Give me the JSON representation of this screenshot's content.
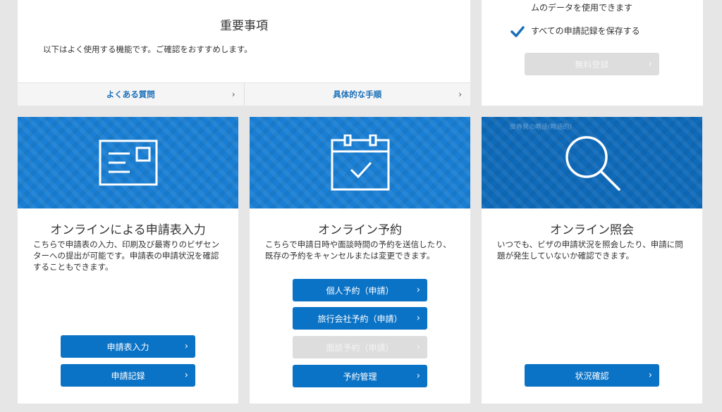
{
  "notice": {
    "title": "重要事項",
    "description": "以下はよく使用する機能です。ご確認をおすすめします。",
    "links": [
      {
        "label": "よくある質問"
      },
      {
        "label": "具体的な手順"
      }
    ],
    "chevron": "›"
  },
  "register": {
    "line1": "ムのデータを使用できます",
    "line2": "すべての申請記録を保存する",
    "button_label": "無料登録",
    "check_icon": "checkmark-icon",
    "check_color": "#1a6fb8"
  },
  "cards": [
    {
      "icon": "application-form-icon",
      "title": "オンラインによる申請表入力",
      "description": "こちらで申請表の入力、印刷及び最寄りのビザセンターへの提出が可能です。申請表の申請状況を確認することもできます。",
      "buttons": [
        {
          "label": "申請表入力",
          "disabled": false
        },
        {
          "label": "申請記録",
          "disabled": false
        }
      ]
    },
    {
      "icon": "calendar-check-icon",
      "title": "オンライン予約",
      "description": "こちらで申請日時や面談時間の予約を送信したり、既存の予約をキャンセルまたは変更できます。",
      "buttons": [
        {
          "label": "個人予約（申請）",
          "disabled": false
        },
        {
          "label": "旅行会社予約（申請）",
          "disabled": false
        },
        {
          "label": "面談予約（申請）",
          "disabled": true
        },
        {
          "label": "予約管理",
          "disabled": false
        }
      ]
    },
    {
      "icon": "search-icon",
      "banner_tag": "旅券発の略語(略語的)",
      "title": "オンライン照会",
      "description": "いつでも、ビザの申請状況を照会したり、申請に問題が発生していないか確認できます。",
      "buttons": [
        {
          "label": "状況確認",
          "disabled": false
        }
      ]
    }
  ],
  "colors": {
    "primary_button": "#0b73c6",
    "disabled_button": "#dddddd",
    "banner": "#1a7fd4",
    "link": "#1a6fb8"
  }
}
